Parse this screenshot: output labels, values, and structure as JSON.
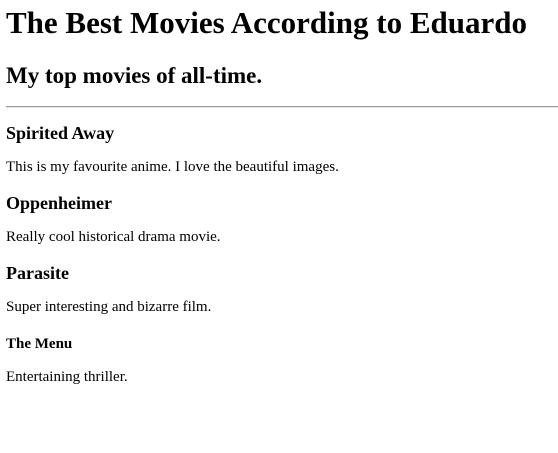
{
  "page": {
    "title": "The Best Movies According to Eduardo",
    "subtitle": "My top movies of all-time."
  },
  "movies": [
    {
      "title": "Spirited Away",
      "description": "This is my favourite anime. I love the beautiful images."
    },
    {
      "title": "Oppenheimer",
      "description": "Really cool historical drama movie."
    },
    {
      "title": "Parasite",
      "description": "Super interesting and bizarre film."
    },
    {
      "title": "The Menu",
      "description": "Entertaining thriller."
    }
  ]
}
